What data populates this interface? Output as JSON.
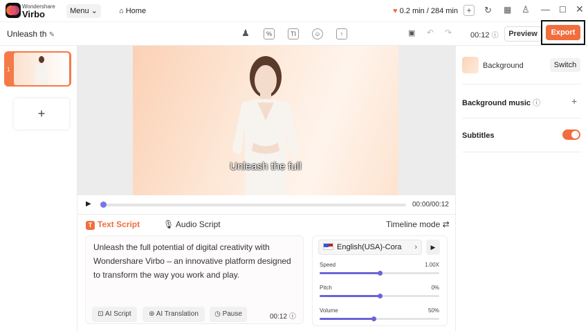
{
  "app": {
    "brand_small": "Wondershare",
    "brand_big": "Virbo"
  },
  "topbar": {
    "menu_label": "Menu",
    "home_label": "Home",
    "usage": "0.2 min / 284 min"
  },
  "toolbar": {
    "project_title": "Unleash th",
    "duration": "00:12",
    "preview_label": "Preview",
    "export_label": "Export",
    "tools": [
      "avatar-icon",
      "pattern-icon",
      "text-icon",
      "sticker-icon",
      "upload-icon"
    ]
  },
  "slides": {
    "items": [
      {
        "number": "1"
      }
    ],
    "add_label": "+"
  },
  "canvas": {
    "subtitle": "Unleash the full"
  },
  "player": {
    "time": "00:00/00:12",
    "progress": 0
  },
  "script": {
    "tab_text": "Text Script",
    "tab_text_icon": "T",
    "tab_audio": "Audio Script",
    "timeline_mode": "Timeline mode ⇄",
    "content": "Unleash the full potential of digital creativity with Wondershare Virbo – an innovative platform designed to transform the way you work and play.",
    "buttons": {
      "ai_script": "AI Script",
      "ai_translation": "AI Translation",
      "pause": "Pause"
    },
    "duration": "00:12"
  },
  "voice": {
    "selected": "English(USA)-Cora",
    "sliders": [
      {
        "label": "Speed",
        "value": "1.00X",
        "level": 0.5
      },
      {
        "label": "Pitch",
        "value": "0%",
        "level": 0.5
      },
      {
        "label": "Volume",
        "value": "50%",
        "level": 0.45
      }
    ]
  },
  "right_panel": {
    "background_label": "Background",
    "switch_label": "Switch",
    "bgm_label": "Background music",
    "subtitles_label": "Subtitles",
    "subtitles_on": true
  },
  "colors": {
    "accent": "#f26d3d",
    "slider": "#6b63d8"
  }
}
